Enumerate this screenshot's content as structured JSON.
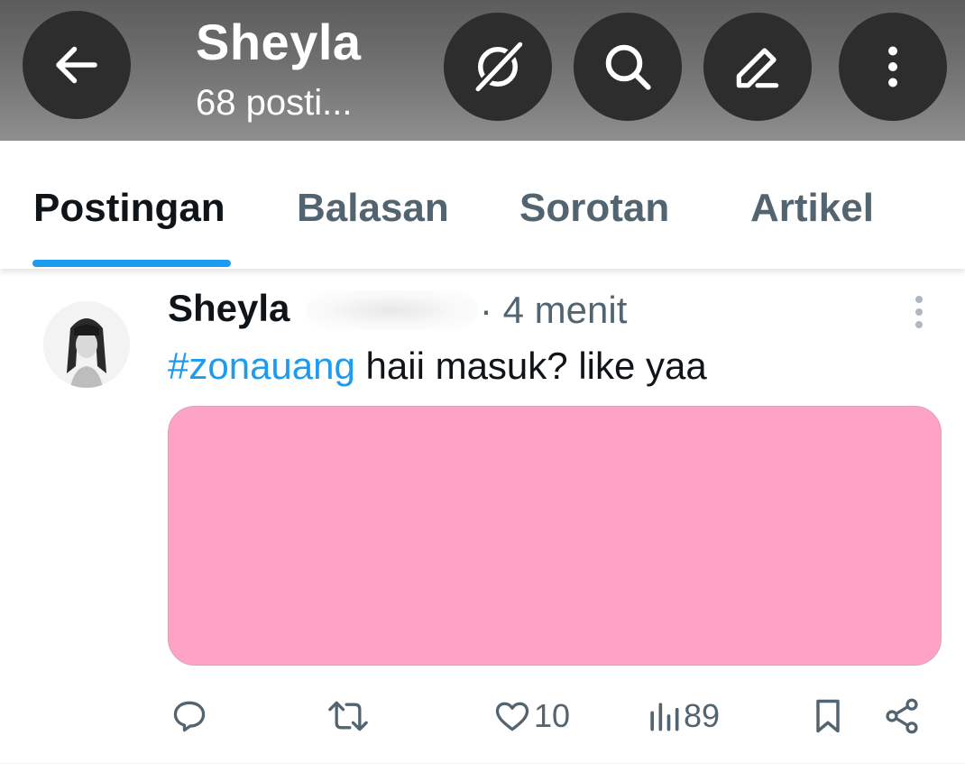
{
  "header": {
    "title": "Sheyla",
    "subtitle": "68 posti...",
    "icons": [
      "back-arrow-icon",
      "grok-icon",
      "search-icon",
      "edit-icon",
      "more-vertical-icon"
    ]
  },
  "tabs": [
    {
      "label": "Postingan",
      "active": true
    },
    {
      "label": "Balasan",
      "active": false
    },
    {
      "label": "Sorotan",
      "active": false
    },
    {
      "label": "Artikel",
      "active": false
    }
  ],
  "post": {
    "author": "Sheyla",
    "time": "· 4 menit",
    "hashtag": "#zonauang",
    "text": " haii masuk? like yaa",
    "media_color": "#ffa3c6",
    "actions": {
      "reply_count": "",
      "retweet_count": "",
      "like_count": "10",
      "views_count": "89"
    }
  },
  "colors": {
    "accent": "#1d9bf0",
    "text_primary": "#0f1419",
    "text_secondary": "#536471",
    "header_button": "#2d2d2d"
  }
}
